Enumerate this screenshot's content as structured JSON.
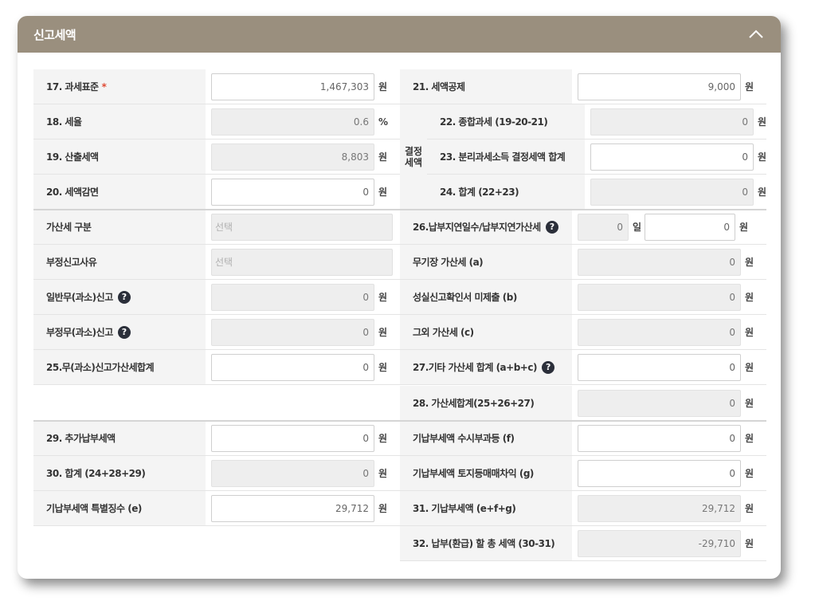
{
  "panel": {
    "title": "신고세액"
  },
  "left": [
    {
      "label": "17. 과세표준",
      "required": "*",
      "value": "1,467,303",
      "unit": "원",
      "ro": false
    },
    {
      "label": "18. 세율",
      "value": "0.6",
      "unit": "%",
      "ro": true
    },
    {
      "label": "19. 산출세액",
      "value": "8,803",
      "unit": "원",
      "ro": true
    },
    {
      "label": "20. 세액감면",
      "value": "0",
      "unit": "원",
      "ro": false
    },
    {
      "label": "가산세 구분",
      "placeholder": "선택",
      "select": true
    },
    {
      "label": "부정신고사유",
      "placeholder": "선택",
      "select": true
    },
    {
      "label": "일반무(과소)신고",
      "help": "?",
      "value": "0",
      "unit": "원",
      "ro": true
    },
    {
      "label": "부정무(과소)신고",
      "help": "?",
      "value": "0",
      "unit": "원",
      "ro": true
    },
    {
      "label": "25.무(과소)신고가산세합계",
      "value": "0",
      "unit": "원",
      "ro": false
    },
    {
      "label": "29. 추가납부세액",
      "value": "0",
      "unit": "원",
      "ro": false
    },
    {
      "label": "30. 합계 (24+28+29)",
      "value": "0",
      "unit": "원",
      "ro": true
    },
    {
      "label": "기납부세액 특별징수 (e)",
      "value": "29,712",
      "unit": "원",
      "ro": false
    }
  ],
  "right_top": [
    {
      "label": "21. 세액공제",
      "value": "9,000",
      "unit": "원",
      "ro": false
    }
  ],
  "group_label": "결정\n세액",
  "right_group": [
    {
      "label": "22. 종합과세 (19-20-21)",
      "value": "0",
      "unit": "원",
      "ro": true
    },
    {
      "label": "23. 분리과세소득 결정세액 합계",
      "value": "0",
      "unit": "원",
      "ro": false
    },
    {
      "label": "24. 합계 (22+23)",
      "value": "0",
      "unit": "원",
      "ro": true
    }
  ],
  "delay": {
    "label": "26.납부지연일수/납부지연가산세",
    "help": "?",
    "days": "0",
    "days_unit": "일",
    "value": "0",
    "unit": "원"
  },
  "right_rest": [
    {
      "label": "무기장 가산세 (a)",
      "value": "0",
      "unit": "원",
      "ro": true
    },
    {
      "label": "성실신고확인서 미제출 (b)",
      "value": "0",
      "unit": "원",
      "ro": true
    },
    {
      "label": "그외 가산세 (c)",
      "value": "0",
      "unit": "원",
      "ro": true
    },
    {
      "label": "27.기타 가산세 합계 (a+b+c)",
      "help": "?",
      "value": "0",
      "unit": "원",
      "ro": false
    },
    {
      "label": "28. 가산세합계(25+26+27)",
      "value": "0",
      "unit": "원",
      "ro": true
    },
    {
      "label": "기납부세액 수시부과등 (f)",
      "value": "0",
      "unit": "원",
      "ro": false
    },
    {
      "label": "기납부세액 토지등매매차익 (g)",
      "value": "0",
      "unit": "원",
      "ro": false
    },
    {
      "label": "31. 기납부세액 (e+f+g)",
      "value": "29,712",
      "unit": "원",
      "ro": true
    },
    {
      "label": "32. 납부(환급) 할 총 세액 (30-31)",
      "value": "-29,710",
      "unit": "원",
      "ro": true
    }
  ]
}
